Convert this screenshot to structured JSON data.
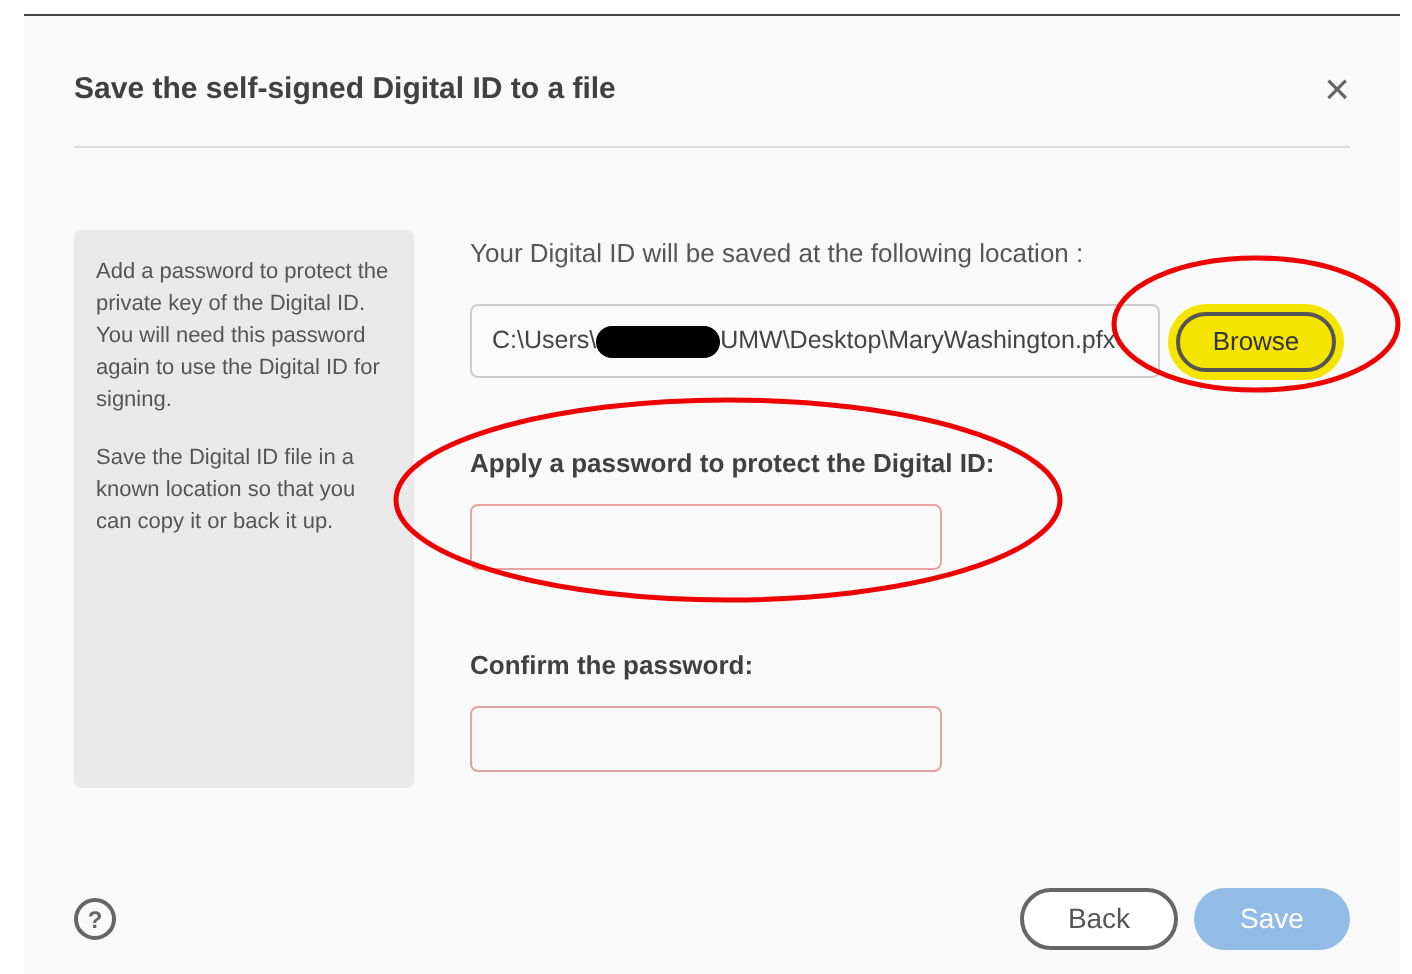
{
  "dialog": {
    "title": "Save the self-signed Digital ID to a file",
    "close": "×"
  },
  "info_panel": {
    "paragraphs": [
      "Add a password to protect the private key of the Digital ID. You will need this password again to use the Digital ID for signing.",
      "Save the Digital ID file in a known location so that you can copy it or back it up."
    ]
  },
  "location": {
    "label": "Your Digital ID will be saved at the following location :",
    "path_start": "C:\\Users\\",
    "path_end": "UMW\\Desktop\\MaryWashington.pfx",
    "redacted": true,
    "browse": "Browse",
    "highlighted": true
  },
  "password": {
    "label": "Apply a password to protect the Digital ID:",
    "invalid": true
  },
  "confirm": {
    "label": "Confirm the password:",
    "invalid": true
  },
  "footer": {
    "help": "?",
    "back": "Back",
    "save": "Save",
    "save_disabled": true
  },
  "annotations": [
    {
      "kind": "ellipse",
      "color": "#ee0000"
    },
    {
      "kind": "ellipse",
      "color": "#ee0000"
    }
  ]
}
